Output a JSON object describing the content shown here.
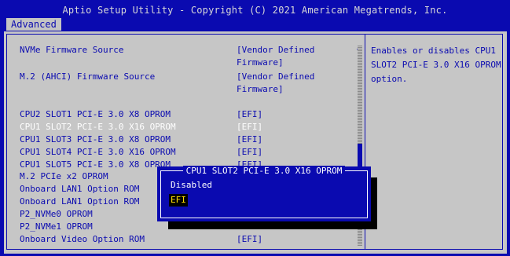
{
  "app": {
    "title": "Aptio Setup Utility - Copyright (C) 2021 American Megatrends, Inc."
  },
  "tabs": [
    {
      "label": "Advanced"
    }
  ],
  "settings": [
    {
      "label": "NVMe Firmware Source",
      "value": "[Vendor Defined",
      "value2": "Firmware]"
    },
    {
      "label": "M.2 (AHCI) Firmware Source",
      "value": "[Vendor Defined",
      "value2": "Firmware]"
    },
    {
      "label": "CPU2 SLOT1 PCI-E 3.0 X8 OPROM",
      "value": "[EFI]"
    },
    {
      "label": "CPU1 SLOT2 PCI-E 3.0 X16 OPROM",
      "value": "[EFI]"
    },
    {
      "label": "CPU1 SLOT3 PCI-E 3.0 X8 OPROM",
      "value": "[EFI]"
    },
    {
      "label": "CPU1 SLOT4 PCI-E 3.0 X16 OPROM",
      "value": "[EFI]"
    },
    {
      "label": "CPU1 SLOT5 PCI-E 3.0 X8 OPROM",
      "value": "[EFI]"
    },
    {
      "label": "M.2 PCIe x2 OPROM",
      "value": ""
    },
    {
      "label": "Onboard LAN1 Option ROM",
      "value": ""
    },
    {
      "label": "Onboard LAN1 Option ROM",
      "value": ""
    },
    {
      "label": "P2_NVMe0 OPROM",
      "value": ""
    },
    {
      "label": "P2_NVMe1 OPROM",
      "value": ""
    },
    {
      "label": "Onboard Video Option ROM",
      "value": "[EFI]"
    }
  ],
  "help": {
    "text": "Enables or disables CPU1\nSLOT2 PCI-E 3.0 X16 OPROM\noption."
  },
  "popup": {
    "title": "CPU1 SLOT2 PCI-E 3.0 X16 OPROM",
    "options": [
      {
        "label": "Disabled"
      },
      {
        "label": "EFI",
        "selected": true
      }
    ]
  },
  "colors": {
    "background": "#0a0ab0",
    "panel": "#c6c6c6",
    "selected_text": "#ffffff",
    "highlight": "#ffe000"
  }
}
